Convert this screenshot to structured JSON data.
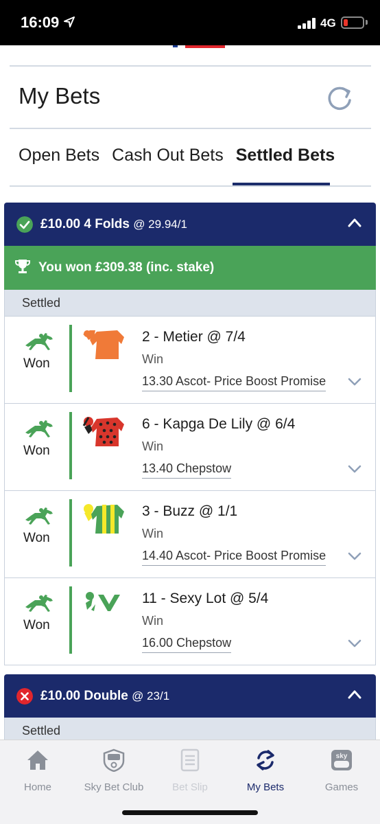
{
  "status_bar": {
    "time": "16:09",
    "network": "4G"
  },
  "header": {
    "title": "My Bets"
  },
  "tabs": [
    {
      "label": "Open Bets",
      "active": false
    },
    {
      "label": "Cash Out Bets",
      "active": false
    },
    {
      "label": "Settled Bets",
      "active": true
    }
  ],
  "bets": [
    {
      "status": "won",
      "stake": "£10.00",
      "bet_type": "4 Folds",
      "odds": "@ 29.94/1",
      "won_text": "You won £309.38 (inc. stake)",
      "settled_label": "Settled",
      "legs": [
        {
          "result": "Won",
          "selection": "2 - Metier @ 7/4",
          "market": "Win",
          "event": "13.30 Ascot- Price Boost Promise"
        },
        {
          "result": "Won",
          "selection": "6 - Kapga De Lily @ 6/4",
          "market": "Win",
          "event": "13.40 Chepstow"
        },
        {
          "result": "Won",
          "selection": "3 - Buzz @ 1/1",
          "market": "Win",
          "event": "14.40 Ascot- Price Boost Promise"
        },
        {
          "result": "Won",
          "selection": "11 - Sexy Lot @ 5/4",
          "market": "Win",
          "event": "16.00 Chepstow"
        }
      ]
    },
    {
      "status": "lost",
      "stake": "£10.00",
      "bet_type": "Double",
      "odds": "@ 23/1",
      "settled_label": "Settled"
    }
  ],
  "bottom_nav": [
    {
      "label": "Home",
      "icon": "home-icon",
      "state": "normal"
    },
    {
      "label": "Sky Bet Club",
      "icon": "sky-bet-club-icon",
      "state": "normal"
    },
    {
      "label": "Bet Slip",
      "icon": "bet-slip-icon",
      "state": "disabled"
    },
    {
      "label": "My Bets",
      "icon": "my-bets-icon",
      "state": "active"
    },
    {
      "label": "Games",
      "icon": "games-icon",
      "state": "normal"
    }
  ],
  "colors": {
    "navy": "#1b2a6b",
    "won_green": "#4aa358",
    "lost_red": "#e1262d",
    "settled_bg": "#dde3ec"
  }
}
